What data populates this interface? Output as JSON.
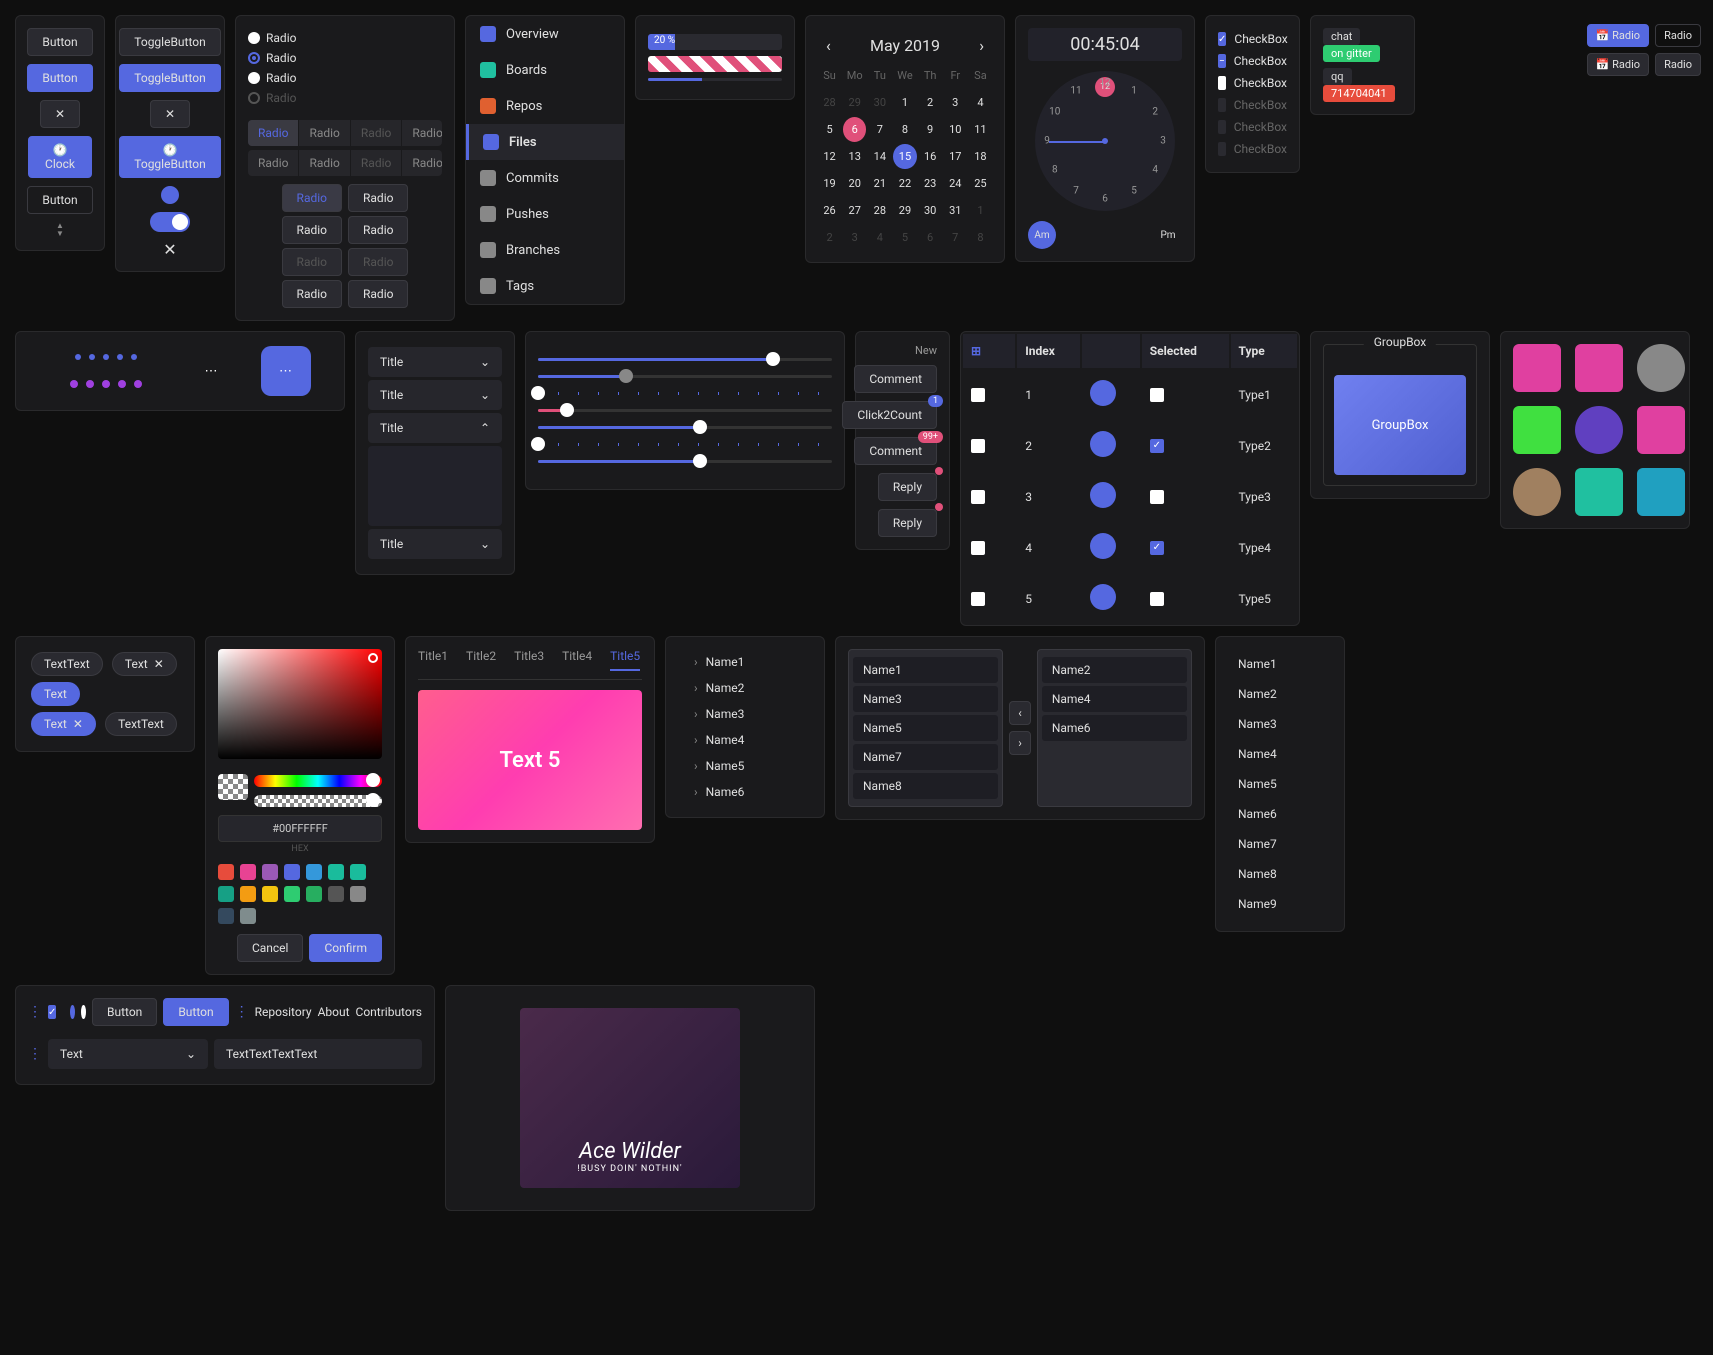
{
  "buttons": {
    "b1": "Button",
    "b2": "Button",
    "b3": "Clock",
    "b4": "Button",
    "t1": "ToggleButton",
    "t2": "ToggleButton",
    "t3": "ToggleButton"
  },
  "radios": {
    "label": "Radio"
  },
  "checkboxes": {
    "label": "CheckBox"
  },
  "badges": {
    "chat": "chat",
    "gitter": "on gitter",
    "qq": "qq",
    "qqnum": "714704041"
  },
  "nav": {
    "items": [
      {
        "label": "Overview"
      },
      {
        "label": "Boards"
      },
      {
        "label": "Repos"
      },
      {
        "label": "Files"
      },
      {
        "label": "Commits"
      },
      {
        "label": "Pushes"
      },
      {
        "label": "Branches"
      },
      {
        "label": "Tags"
      }
    ]
  },
  "progress": {
    "pct": "20 %"
  },
  "dropdowns": {
    "title": "Title"
  },
  "calendar": {
    "month": "May 2019",
    "dow": [
      "Su",
      "Mo",
      "Tu",
      "We",
      "Th",
      "Fr",
      "Sa"
    ],
    "prev": [
      28,
      29,
      30
    ],
    "days": [
      1,
      2,
      3,
      4,
      5,
      6,
      7,
      8,
      9,
      10,
      11,
      12,
      13,
      14,
      15,
      16,
      17,
      18,
      19,
      20,
      21,
      22,
      23,
      24,
      25,
      26,
      27,
      28,
      29,
      30,
      31
    ],
    "next": [
      1,
      2,
      3,
      4,
      5,
      6,
      7,
      8
    ],
    "sel_pink": 6,
    "sel_blue": 15
  },
  "time": {
    "display": "00:45:04",
    "am": "Am",
    "pm": "Pm",
    "marker": "12"
  },
  "notif": {
    "new": "New",
    "comment": "Comment",
    "click2count": "Click2Count",
    "reply": "Reply",
    "n1": "1",
    "n99": "99+"
  },
  "table": {
    "cols": [
      "Index",
      "Selected",
      "Type"
    ],
    "rows": [
      {
        "index": "1",
        "type": "Type1",
        "checked": false
      },
      {
        "index": "2",
        "type": "Type2",
        "checked": true
      },
      {
        "index": "3",
        "type": "Type3",
        "checked": false
      },
      {
        "index": "4",
        "type": "Type4",
        "checked": true
      },
      {
        "index": "5",
        "type": "Type5",
        "checked": false
      }
    ]
  },
  "groupbox": {
    "title": "GroupBox",
    "inner": "GroupBox"
  },
  "tabs": {
    "items": [
      "Title1",
      "Title2",
      "Title3",
      "Title4",
      "Title5"
    ],
    "content": "Text 5"
  },
  "tree": {
    "items": [
      "Name1",
      "Name2",
      "Name3",
      "Name4",
      "Name5",
      "Name6"
    ]
  },
  "transfer": {
    "left": [
      "Name1",
      "Name3",
      "Name5",
      "Name7",
      "Name8"
    ],
    "right": [
      "Name2",
      "Name4",
      "Name6"
    ]
  },
  "plainlist": {
    "items": [
      "Name1",
      "Name2",
      "Name3",
      "Name4",
      "Name5",
      "Name6",
      "Name7",
      "Name8",
      "Name9"
    ]
  },
  "chips": {
    "c1": "TextText",
    "c2": "Text",
    "c3": "Text",
    "c4": "Text",
    "c5": "TextText"
  },
  "colorpicker": {
    "hex": "#00FFFFFF",
    "hexlabel": "HEX",
    "cancel": "Cancel",
    "confirm": "Confirm",
    "swatches": [
      "#e74c3c",
      "#e84393",
      "#9b59b6",
      "#5568e0",
      "#3498db",
      "#1abc9c",
      "#1abc9c",
      "#16a085",
      "#f39c12",
      "#f1c40f",
      "#2ecc71",
      "#27ae60",
      "#555",
      "#888",
      "#34495e",
      "#7f8c8d"
    ]
  },
  "toolbar": {
    "button": "Button",
    "repository": "Repository",
    "about": "About",
    "contributors": "Contributors",
    "selectText": "Text",
    "textInput": "TextTextTextText"
  },
  "carousel": {
    "artist": "Ace Wilder",
    "subtitle": "!BUSY DOIN' NOTHIN'"
  }
}
